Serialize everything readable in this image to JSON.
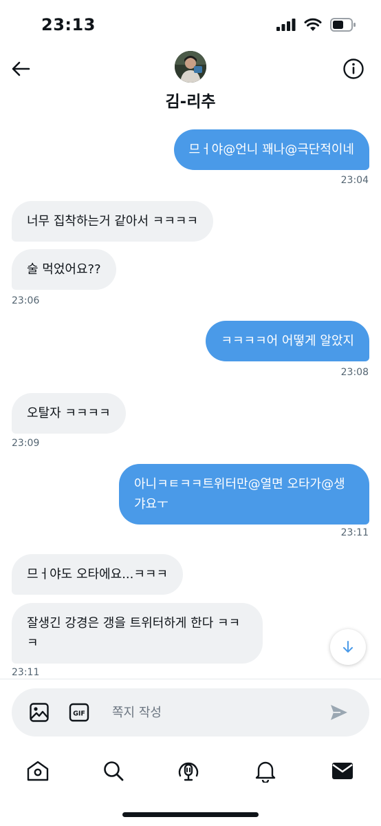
{
  "status_bar": {
    "time": "23:13"
  },
  "header": {
    "contact_name": "김-리추"
  },
  "messages": [
    {
      "side": "out",
      "text": "므ㅓ야@언니 꽤나@극단적이네",
      "timestamp": "23:04"
    },
    {
      "side": "in",
      "text": "너무 집착하는거 같아서 ㅋㅋㅋㅋ"
    },
    {
      "side": "in",
      "text": "술 먹었어요??",
      "timestamp": "23:06"
    },
    {
      "side": "out",
      "text": "ㅋㅋㅋㅋ어 어떻게 알았지",
      "timestamp": "23:08"
    },
    {
      "side": "in",
      "text": "오탈자 ㅋㅋㅋㅋ",
      "timestamp": "23:09"
    },
    {
      "side": "out",
      "text": "아니ㅋㅌㅋㅋ트위터만@열면 오타가@생갸요ㅜ",
      "timestamp": "23:11"
    },
    {
      "side": "in",
      "text": "므ㅓ야도 오타에요...ㅋㅋㅋ"
    },
    {
      "side": "in",
      "text": "잘생긴 강경은 갱을 트위터하게 한다 ㅋㅋㅋ",
      "timestamp": "23:11"
    }
  ],
  "composer": {
    "placeholder": "쪽지 작성",
    "value": ""
  },
  "icons": {
    "back": "back-arrow-icon",
    "info": "info-icon",
    "scroll_down": "arrow-down-icon",
    "image": "image-icon",
    "gif": "gif-icon",
    "send": "send-icon",
    "nav": [
      "home-icon",
      "search-icon",
      "spaces-icon",
      "notifications-icon",
      "messages-icon"
    ]
  },
  "colors": {
    "accent": "#4a9ae8",
    "incoming_bubble": "#eff1f3",
    "text": "#0f1419",
    "muted": "#536471"
  }
}
